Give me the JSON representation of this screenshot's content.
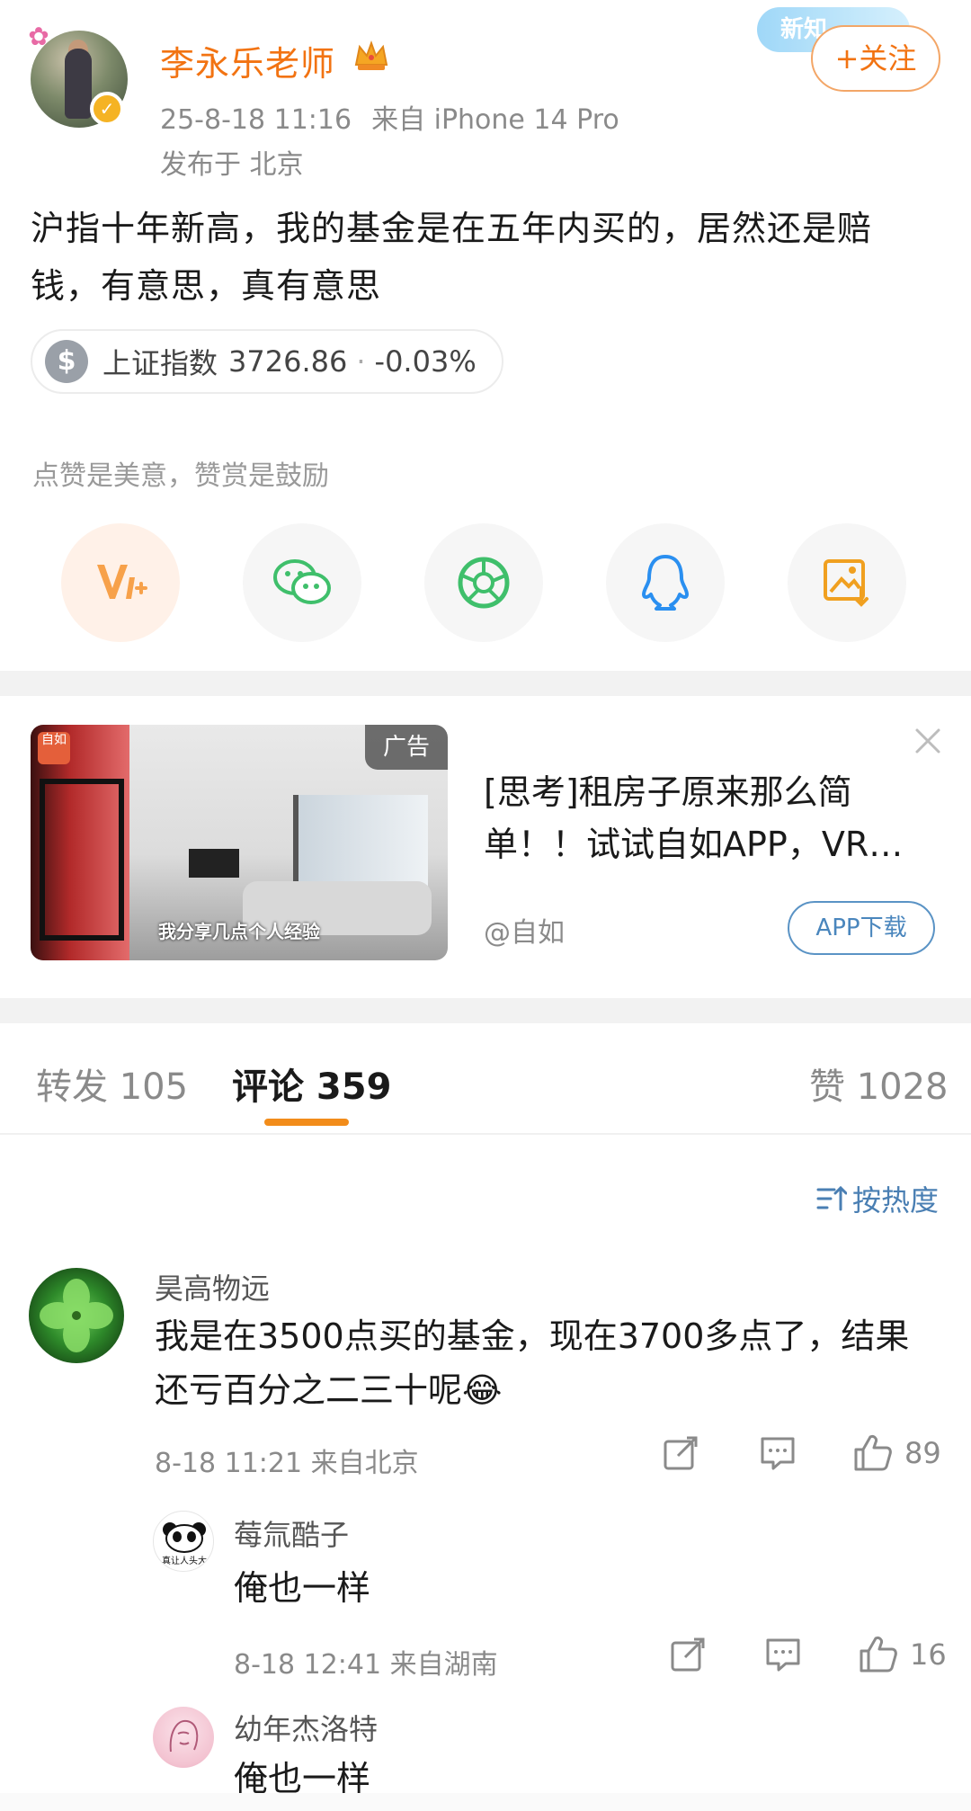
{
  "post": {
    "username": "李永乐老师",
    "timestamp": "25-8-18 11:16",
    "source": "来自 iPhone 14 Pro",
    "location": "发布于 北京",
    "follow_label": "+关注",
    "deco_badge": "新知",
    "text": "沪指十年新高，我的基金是在五年内买的，居然还是赔钱，有意思，真有意思",
    "stock": {
      "name": "上证指数",
      "value": "3726.86",
      "separator": "·",
      "change": "-0.03%"
    },
    "reward_note": "点赞是美意，赞赏是鼓励",
    "share_icons": [
      "reward-icon",
      "wechat-icon",
      "moments-icon",
      "qq-icon",
      "save-image-icon"
    ]
  },
  "ad": {
    "tag": "广告",
    "brand": "自如",
    "caption": "我分享几点个人经验",
    "title": "[思考]租房子原来那么简单！！试试自如APP，VR…",
    "source": "@自如",
    "button": "APP下载"
  },
  "tabs": {
    "repost": "转发 105",
    "comment": "评论 359",
    "like": "赞 1028"
  },
  "sort_label": "按热度",
  "comments": [
    {
      "name": "昊高物远",
      "text": "我是在3500点买的基金，现在3700多点了，结果还亏百分之二三十呢",
      "emoji": "😂",
      "meta": "8-18 11:21 来自北京",
      "likes": "89"
    },
    {
      "name": "莓氚酷子",
      "text": "俺也一样",
      "meta": "8-18 12:41 来自湖南",
      "likes": "16",
      "avatar_caption": "真让人头大"
    },
    {
      "name": "幼年杰洛特",
      "text": "俺也一样"
    }
  ],
  "colors": {
    "accent_orange": "#f27312",
    "link_blue": "#4a7fb3",
    "tab_indicator": "#f28c1a"
  }
}
